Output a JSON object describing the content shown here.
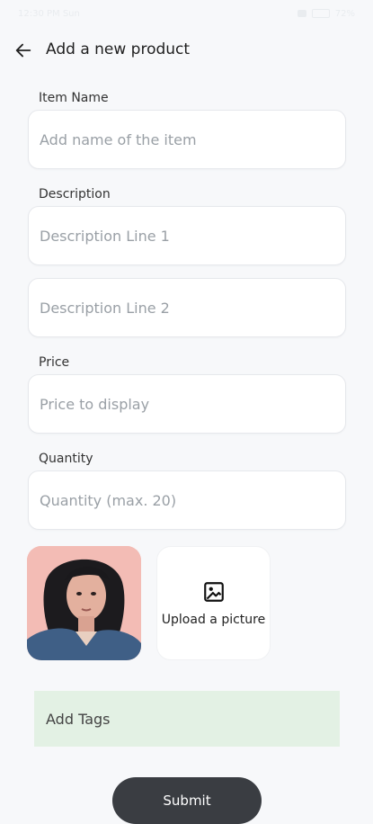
{
  "statusbar": {
    "left_text": "12:30 PM Sun",
    "right_text": "72%"
  },
  "header": {
    "back_icon": "arrow-left-icon",
    "title": "Add a new product"
  },
  "form": {
    "item_name": {
      "label": "Item Name",
      "placeholder": "Add name of the item",
      "value": ""
    },
    "description": {
      "label": "Description",
      "line1_placeholder": "Description Line 1",
      "line2_placeholder": "Description Line 2",
      "line1_value": "",
      "line2_value": ""
    },
    "price": {
      "label": "Price",
      "placeholder": "Price to display",
      "value": ""
    },
    "quantity": {
      "label": "Quantity",
      "placeholder": "Quantity (max. 20)",
      "value": ""
    },
    "upload": {
      "icon": "image-icon",
      "label": "Upload a picture"
    },
    "tags": {
      "label": "Add Tags"
    },
    "submit": {
      "label": "Submit"
    }
  },
  "colors": {
    "background": "#f7f8fa",
    "field_border": "#e6e8ec",
    "tags_background": "#e3f1e4",
    "submit_background": "#3a3d42"
  }
}
